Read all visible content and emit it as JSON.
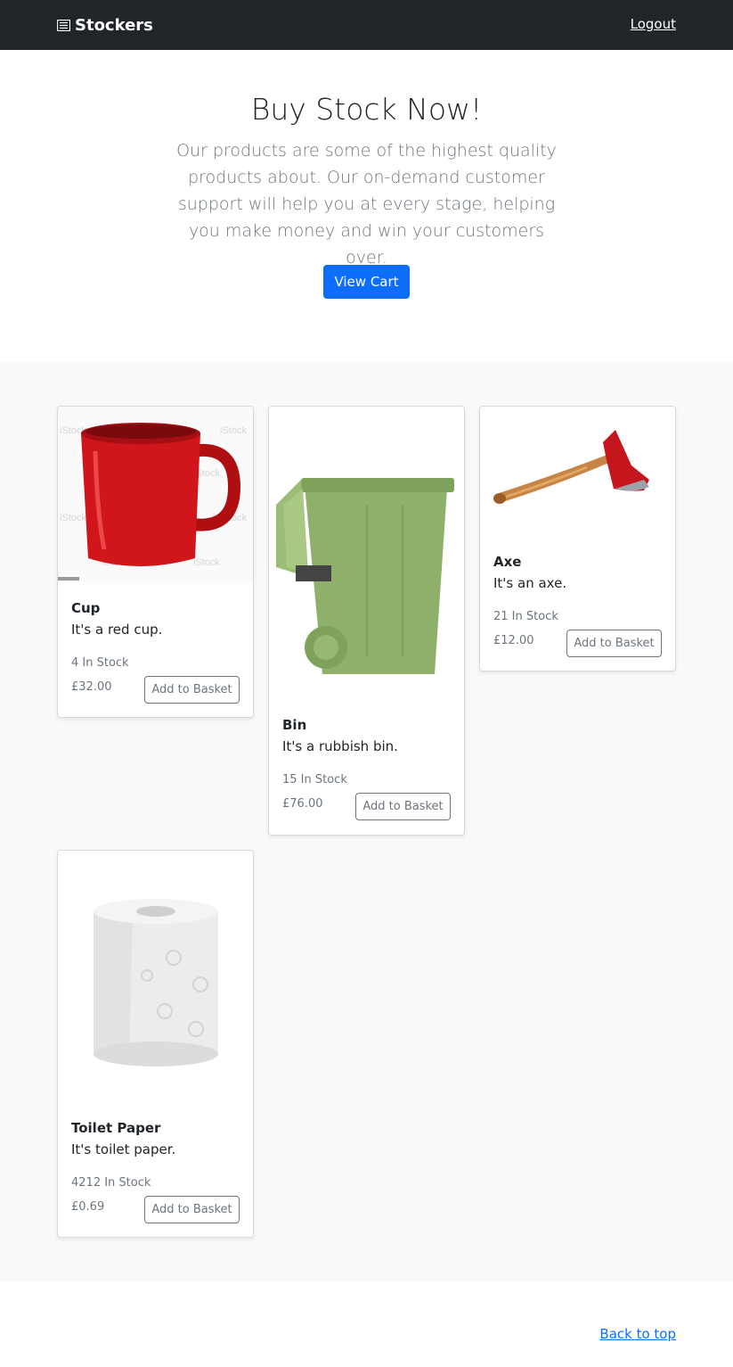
{
  "nav": {
    "brand": "Stockers",
    "logout": "Logout"
  },
  "hero": {
    "title": "Buy Stock Now!",
    "lead": "Our products are some of the highest quality products about. Our on-demand customer support will help you at every stage, helping you make money and win your customers over.",
    "cta": "View Cart"
  },
  "products": [
    {
      "name": "Cup",
      "description": "It's a red cup.",
      "stock": "4 In Stock",
      "price": "£32.00",
      "button": "Add to Basket"
    },
    {
      "name": "Bin",
      "description": "It's a rubbish bin.",
      "stock": "15 In Stock",
      "price": "£76.00",
      "button": "Add to Basket"
    },
    {
      "name": "Axe",
      "description": "It's an axe.",
      "stock": "21 In Stock",
      "price": "£12.00",
      "button": "Add to Basket"
    },
    {
      "name": "Toilet Paper",
      "description": "It's toilet paper.",
      "stock": "4212 In Stock",
      "price": "£0.69",
      "button": "Add to Basket"
    }
  ],
  "footer": {
    "back_to_top": "Back to top"
  },
  "colors": {
    "navbar": "#212529",
    "primary": "#0d6efd",
    "album_bg": "#f8f9fa",
    "muted": "#6c757d"
  },
  "icons": {
    "brand": "newspaper-icon"
  }
}
